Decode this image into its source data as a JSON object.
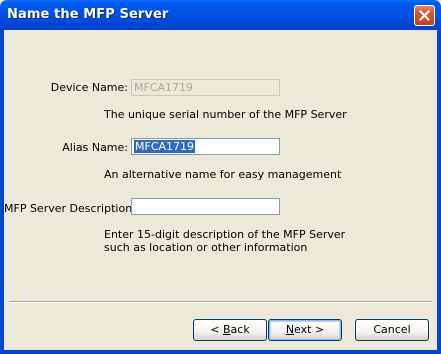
{
  "window": {
    "title": "Name the MFP Server"
  },
  "icons": {
    "close": "close-icon"
  },
  "device": {
    "label": "Device Name:",
    "value": "MFCA1719",
    "help": "The unique serial number of the MFP Server"
  },
  "alias": {
    "label": "Alias Name:",
    "value": "MFCA1719",
    "help": "An alternative name for easy management"
  },
  "description": {
    "label": "MFP Server Description:",
    "value": "",
    "help_line1": "Enter 15-digit description of the MFP Server",
    "help_line2": "such as location or other information"
  },
  "buttons": {
    "back_prefix": "< ",
    "back_acc": "B",
    "back_rest": "ack",
    "next_acc": "N",
    "next_rest": "ext >",
    "cancel": "Cancel"
  },
  "colors": {
    "titlebar": "#0054e3",
    "selection": "#316ac5",
    "face": "#ece9d8"
  }
}
